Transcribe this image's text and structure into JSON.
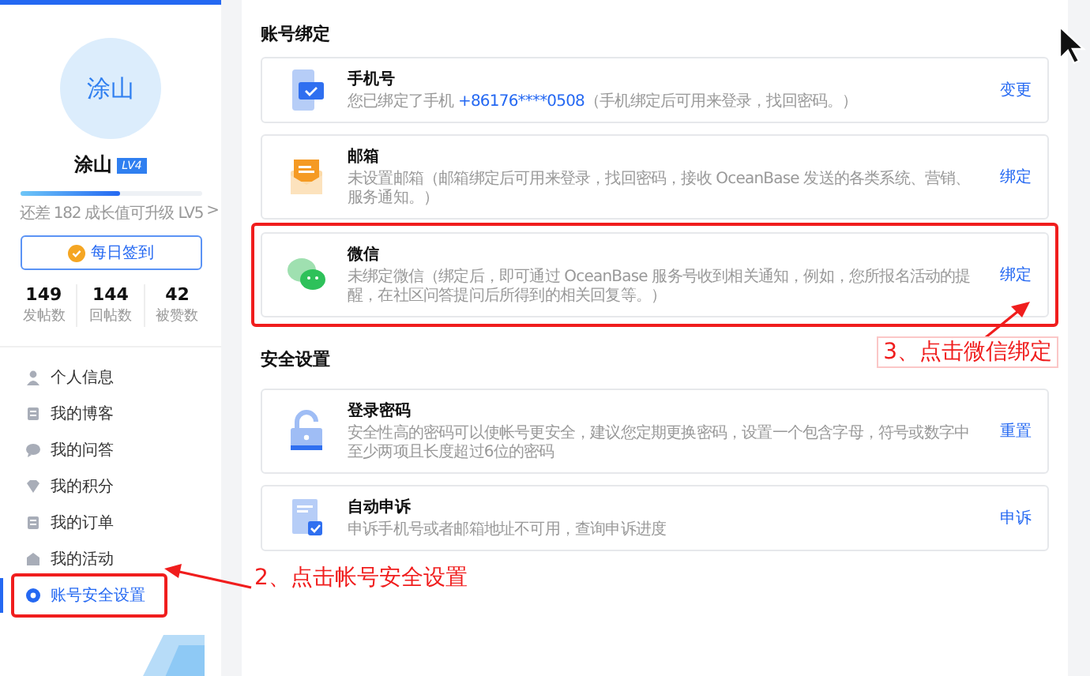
{
  "profile": {
    "avatar_text": "涂山",
    "name": "涂山",
    "level_badge": "LV4",
    "progress": {
      "level": 0.55
    },
    "growth_hint": "还差 182 成长值可升级 LV5",
    "growth_caret": ">",
    "checkin_button": "每日签到",
    "stats": [
      {
        "value": "149",
        "label": "发帖数"
      },
      {
        "value": "144",
        "label": "回帖数"
      },
      {
        "value": "42",
        "label": "被赞数"
      }
    ]
  },
  "sidebar": {
    "items": [
      {
        "label": "个人信息",
        "kind": "person",
        "selected": false,
        "annotated": false
      },
      {
        "label": "我的博客",
        "kind": "doc",
        "selected": false,
        "annotated": false
      },
      {
        "label": "我的问答",
        "kind": "chat",
        "selected": false,
        "annotated": false
      },
      {
        "label": "我的积分",
        "kind": "gem",
        "selected": false,
        "annotated": false
      },
      {
        "label": "我的订单",
        "kind": "order",
        "selected": false,
        "annotated": false
      },
      {
        "label": "我的活动",
        "kind": "event",
        "selected": false,
        "annotated": false
      },
      {
        "label": "账号安全设置",
        "kind": "gear",
        "selected": true,
        "annotated": true
      }
    ]
  },
  "sections": [
    {
      "title": "账号绑定",
      "cards": [
        {
          "kind": "phone",
          "title": "手机号",
          "desc": [
            {
              "kind": "text",
              "text": "您已绑定了手机 "
            },
            {
              "kind": "link",
              "text": "+86176****0508"
            },
            {
              "kind": "text",
              "text": "（手机绑定后可用来登录，找回密码。）"
            }
          ],
          "action": "变更",
          "annotated": false
        },
        {
          "kind": "mail",
          "title": "邮箱",
          "desc": [
            {
              "kind": "text",
              "text": "未设置邮箱（邮箱绑定后可用来登录，找回密码，接收 OceanBase 发送的各类系统、营销、服务通知。）"
            }
          ],
          "action": "绑定",
          "annotated": false
        },
        {
          "kind": "wechat",
          "title": "微信",
          "desc": [
            {
              "kind": "text",
              "text": "未绑定微信（绑定后，即可通过 OceanBase 服务号收到相关通知，例如，您所报名活动的提醒，在社区问答提问后所得到的相关回复等。）"
            }
          ],
          "action": "绑定",
          "annotated": true
        }
      ]
    },
    {
      "title": "安全设置",
      "cards": [
        {
          "kind": "lock",
          "title": "登录密码",
          "desc": [
            {
              "kind": "text",
              "text": "安全性高的密码可以使帐号更安全，建议您定期更换密码，设置一个包含字母，符号或数字中至少两项且长度超过6位的密码"
            }
          ],
          "action": "重置",
          "annotated": false
        },
        {
          "kind": "appeal",
          "title": "自动申诉",
          "desc": [
            {
              "kind": "text",
              "text": "申诉手机号或者邮箱地址不可用，查询申诉进度"
            }
          ],
          "action": "申诉",
          "annotated": false
        }
      ]
    }
  ],
  "annotations": [
    {
      "kind": "sidebar",
      "text": "2、点击帐号安全设置"
    },
    {
      "kind": "card",
      "text": "3、点击微信绑定"
    }
  ]
}
